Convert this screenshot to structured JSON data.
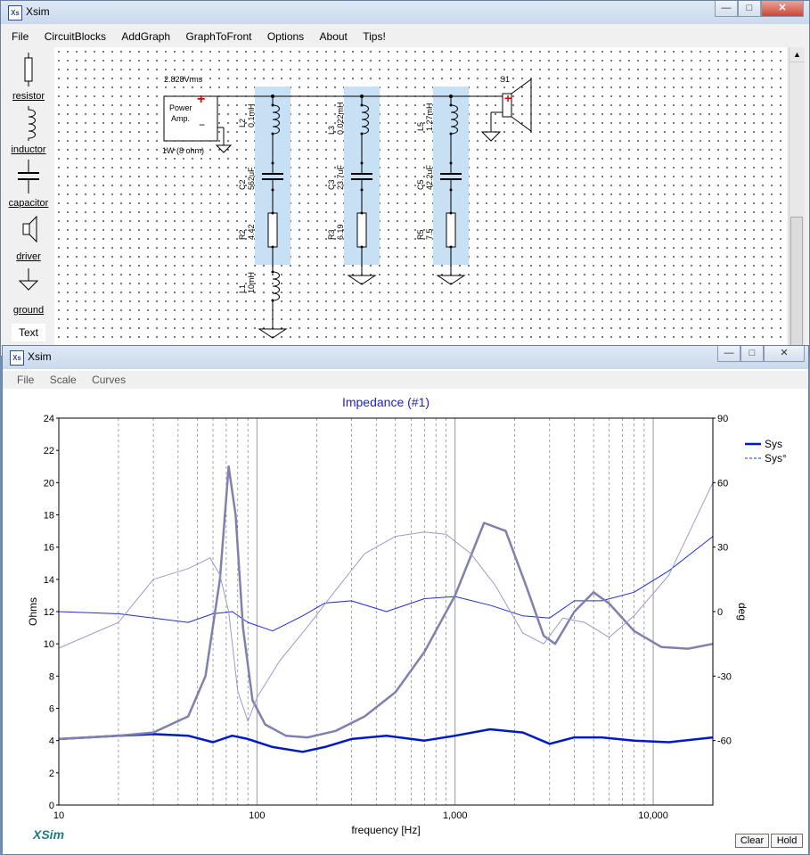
{
  "main_window": {
    "title": "Xsim",
    "menu": [
      "File",
      "CircuitBlocks",
      "AddGraph",
      "GraphToFront",
      "Options",
      "About",
      "Tips!"
    ],
    "toolbox": [
      {
        "label": "resistor",
        "icon": "resistor-icon"
      },
      {
        "label": "inductor",
        "icon": "inductor-icon"
      },
      {
        "label": "capacitor",
        "icon": "capacitor-icon"
      },
      {
        "label": "driver",
        "icon": "driver-icon"
      },
      {
        "label": "ground",
        "icon": "ground-icon"
      },
      {
        "label": "Text",
        "icon": ""
      }
    ]
  },
  "schematic": {
    "source": {
      "voltage": "2.828Vrms",
      "line1": "Power",
      "line2": "Amp.",
      "power": "1W (8 ohm)",
      "plus": "+",
      "minus": "−"
    },
    "driver": {
      "name": "S1",
      "plus": "+"
    },
    "branches": [
      {
        "inductor": {
          "ref": "L2",
          "value": "0.1mH"
        },
        "capacitor": {
          "ref": "C2",
          "value": "562uF"
        },
        "resistor": {
          "ref": "R2",
          "value": "4.42"
        },
        "extra_inductor": {
          "ref": "L1",
          "value": "10mH"
        }
      },
      {
        "inductor": {
          "ref": "L3",
          "value": "0.022mH"
        },
        "capacitor": {
          "ref": "C3",
          "value": "23.7uF"
        },
        "resistor": {
          "ref": "R3",
          "value": "6.19"
        }
      },
      {
        "inductor": {
          "ref": "L5",
          "value": "1.27mH"
        },
        "capacitor": {
          "ref": "C5",
          "value": "42.2uF"
        },
        "resistor": {
          "ref": "R5",
          "value": "7.5"
        }
      }
    ]
  },
  "graph_window": {
    "title": "Xsim",
    "menu": [
      "File",
      "Scale",
      "Curves"
    ],
    "brand": "XSim",
    "buttons": {
      "clear": "Clear",
      "hold": "Hold"
    }
  },
  "colors": {
    "magnitude": "#0019c8",
    "phase": "#1e2ddc",
    "held_magnitude": "#8080b0",
    "held_phase": "#9a9ad0",
    "highlight": "#c7e0f4",
    "title": "#1f1fd4",
    "brand": "#1a7e7e"
  },
  "chart_data": {
    "type": "line",
    "title": "Impedance (#1)",
    "xlabel": "frequency [Hz]",
    "ylabel": "Ohms",
    "y2label": "deg",
    "x_scale": "log",
    "xlim": [
      10,
      20000
    ],
    "ylim": [
      0,
      24
    ],
    "y2lim": [
      -90,
      90
    ],
    "x_tick_labels": [
      "10",
      "100",
      "1,000",
      "10,000"
    ],
    "y_ticks": [
      "0",
      "2",
      "4",
      "6",
      "8",
      "10",
      "12",
      "14",
      "16",
      "18",
      "20",
      "22",
      "24"
    ],
    "y2_ticks": [
      "-60",
      "-30",
      "0",
      "30",
      "60",
      "90"
    ],
    "legend_position": "top-right",
    "series": [
      {
        "name": "Sys",
        "axis": "left",
        "style": "solid",
        "x": [
          10,
          20,
          30,
          45,
          60,
          75,
          90,
          120,
          170,
          220,
          300,
          450,
          700,
          1000,
          1500,
          2200,
          3000,
          4000,
          5500,
          8000,
          12000,
          20000
        ],
        "y": [
          4.1,
          4.3,
          4.4,
          4.3,
          3.9,
          4.3,
          4.1,
          3.6,
          3.3,
          3.6,
          4.1,
          4.3,
          4.0,
          4.3,
          4.7,
          4.5,
          3.8,
          4.2,
          4.2,
          4.0,
          3.9,
          4.2
        ]
      },
      {
        "name": "Sys°",
        "axis": "right",
        "style": "dashed",
        "x": [
          10,
          20,
          30,
          45,
          60,
          75,
          90,
          120,
          170,
          220,
          300,
          450,
          700,
          1000,
          1500,
          2200,
          3000,
          4000,
          5500,
          8000,
          12000,
          20000
        ],
        "y": [
          0,
          -1,
          -3,
          -5,
          -1,
          0,
          -5,
          -9,
          -2,
          4,
          5,
          0,
          6,
          7,
          3,
          -2,
          -3,
          5,
          5,
          9,
          19,
          35
        ]
      },
      {
        "axis": "left",
        "style": "held",
        "x": [
          10,
          20,
          30,
          45,
          55,
          65,
          72,
          78,
          85,
          95,
          110,
          140,
          180,
          250,
          350,
          500,
          700,
          1000,
          1400,
          1800,
          2300,
          2800,
          3200,
          4000,
          5000,
          6000,
          8000,
          11000,
          15000,
          20000
        ],
        "y": [
          4.1,
          4.3,
          4.5,
          5.5,
          8.0,
          14.0,
          21.0,
          18.0,
          11.0,
          6.5,
          5.0,
          4.3,
          4.2,
          4.6,
          5.5,
          7.0,
          9.5,
          13.0,
          17.5,
          17.0,
          13.5,
          10.5,
          10.0,
          12.0,
          13.2,
          12.5,
          10.8,
          9.8,
          9.7,
          10.0
        ]
      },
      {
        "axis": "right",
        "style": "held",
        "x": [
          10,
          20,
          30,
          45,
          58,
          65,
          72,
          80,
          90,
          100,
          130,
          180,
          250,
          350,
          500,
          700,
          900,
          1200,
          1600,
          2200,
          2800,
          3500,
          4500,
          6000,
          8000,
          12000,
          20000
        ],
        "y": [
          -17,
          -5,
          15,
          20,
          25,
          17,
          0,
          -37,
          -51,
          -40,
          -23,
          -7,
          10,
          27,
          35,
          37,
          36,
          27,
          12,
          -10,
          -15,
          -3,
          -5,
          -12,
          -2,
          17,
          60
        ]
      }
    ]
  }
}
